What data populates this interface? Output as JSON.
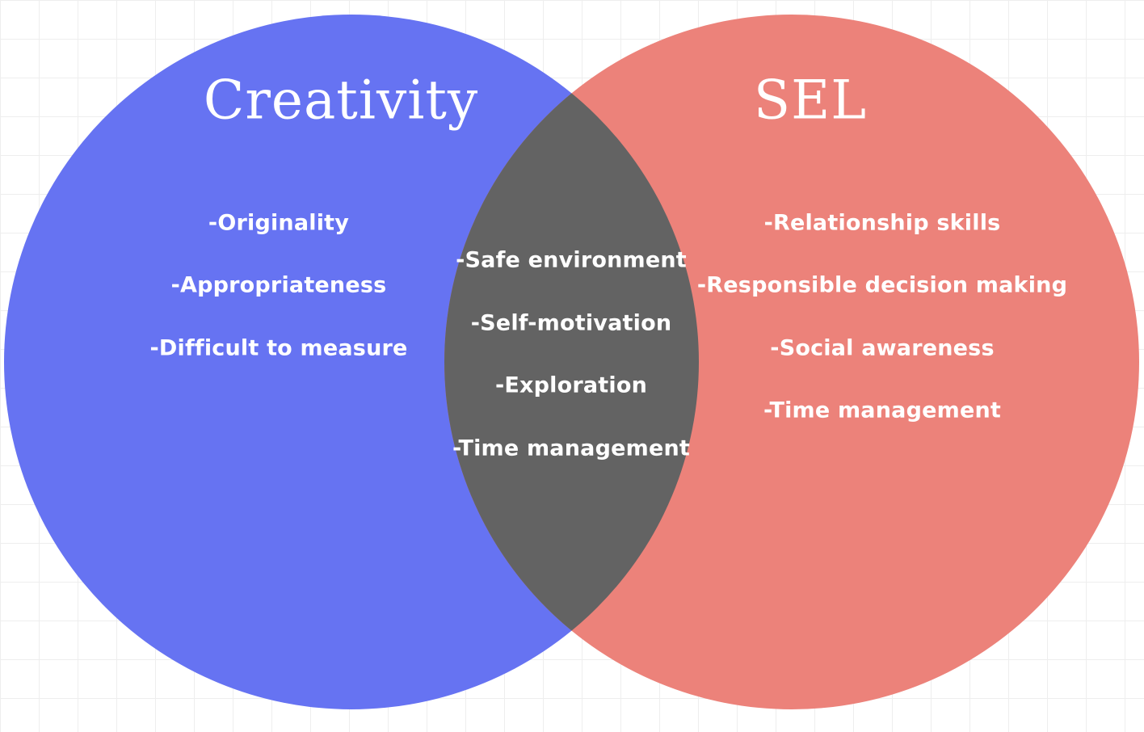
{
  "venn": {
    "left": {
      "title": "Creativity",
      "color": "#6673f2",
      "items": [
        "-Originality",
        "-Appropriateness",
        "-Difficult to measure"
      ]
    },
    "right": {
      "title": "SEL",
      "color": "#ec827a",
      "items": [
        "-Relationship skills",
        "-Responsible decision making",
        "-Social awareness",
        "-Time management"
      ]
    },
    "overlap": {
      "color": "#636363",
      "items": [
        "-Safe environment",
        "-Self-motivation",
        "-Exploration",
        "-Time management"
      ]
    }
  }
}
